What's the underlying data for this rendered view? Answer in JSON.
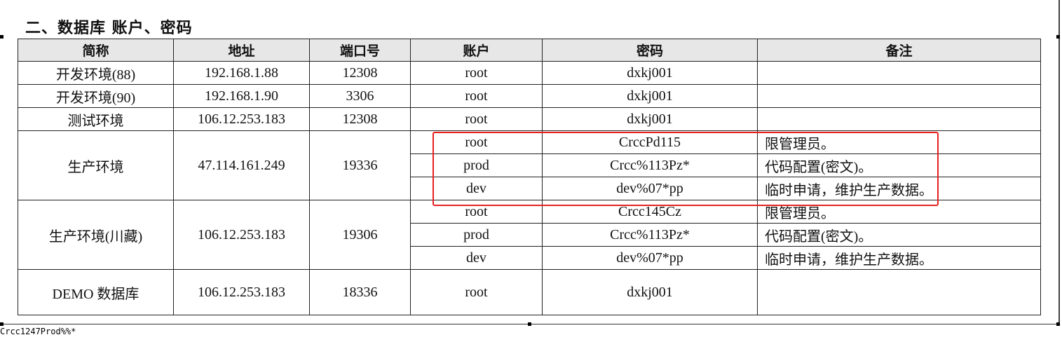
{
  "heading": "二、数据库 账户、密码",
  "table": {
    "headers": [
      "简称",
      "地址",
      "端口号",
      "账户",
      "密码",
      "备注"
    ],
    "rows": [
      {
        "name": "开发环境(88)",
        "address": "192.168.1.88",
        "port": "12308",
        "account": "root",
        "password": "dxkj001",
        "note": ""
      },
      {
        "name": "开发环境(90)",
        "address": "192.168.1.90",
        "port": "3306",
        "account": "root",
        "password": "dxkj001",
        "note": ""
      },
      {
        "name": "测试环境",
        "address": "106.12.253.183",
        "port": "12308",
        "account": "root",
        "password": "dxkj001",
        "note": ""
      }
    ],
    "groups": [
      {
        "name": "生产环境",
        "address": "47.114.161.249",
        "port": "19336",
        "accounts": [
          {
            "account": "root",
            "password": "CrccPd115",
            "note": "限管理员。"
          },
          {
            "account": "prod",
            "password": "Crcc%113Pz*",
            "note": "代码配置(密文)。"
          },
          {
            "account": "dev",
            "password": "dev%07*pp",
            "note": "临时申请，维护生产数据。"
          }
        ]
      },
      {
        "name": "生产环境(川藏)",
        "address": "106.12.253.183",
        "port": "19306",
        "accounts": [
          {
            "account": "root",
            "password": "Crcc145Cz",
            "note": "限管理员。"
          },
          {
            "account": "prod",
            "password": "Crcc%113Pz*",
            "note": "代码配置(密文)。"
          },
          {
            "account": "dev",
            "password": "dev%07*pp",
            "note": "临时申请，维护生产数据。"
          }
        ]
      }
    ],
    "demo": {
      "name": "DEMO 数据库",
      "address": "106.12.253.183",
      "port": "18336",
      "account": "root",
      "password": "dxkj001",
      "note": ""
    }
  },
  "footer_text": "Crcc1247Prod%%*",
  "colors": {
    "highlight": "#e8201f",
    "header_bg": "#e7e7e7"
  }
}
